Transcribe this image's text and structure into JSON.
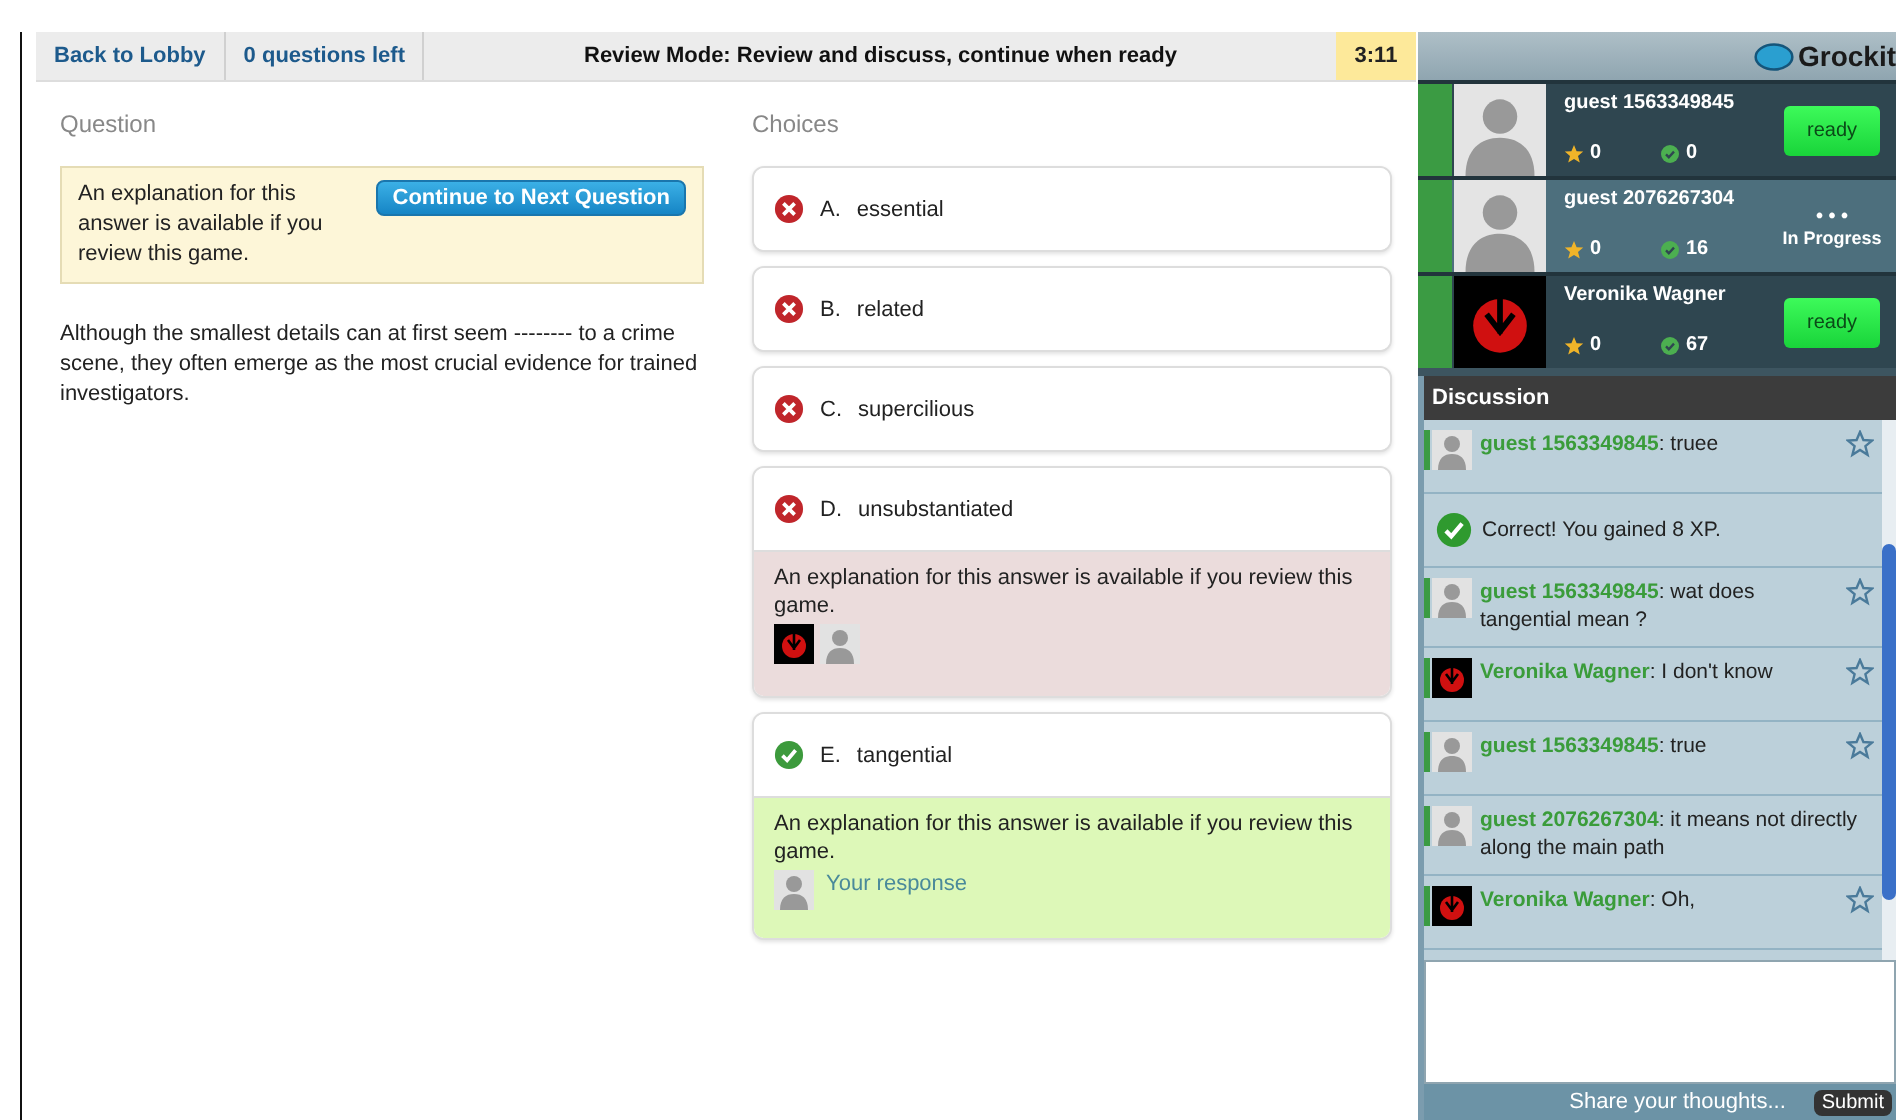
{
  "topbar": {
    "back": "Back to Lobby",
    "remaining": "0 questions left",
    "mode": "Review Mode: Review and discuss, continue when ready",
    "timer": "3:11"
  },
  "question": {
    "heading": "Question",
    "notice": "An explanation for this answer is available if you review this game.",
    "continue_button": "Continue to Next Question",
    "text": "Although the smallest details can at first seem -------- to a crime scene, they often emerge as the most crucial evidence for trained investigators."
  },
  "choices": {
    "heading": "Choices",
    "items": [
      {
        "letter": "A.",
        "text": "essential",
        "correct": false,
        "expanded": false
      },
      {
        "letter": "B.",
        "text": "related",
        "correct": false,
        "expanded": false
      },
      {
        "letter": "C.",
        "text": "supercilious",
        "correct": false,
        "expanded": false
      },
      {
        "letter": "D.",
        "text": "unsubstantiated",
        "correct": false,
        "expanded": true,
        "explanation": "An explanation for this answer is available if you review this game.",
        "responders": [
          {
            "kind": "emblem"
          },
          {
            "kind": "silhouette"
          }
        ]
      },
      {
        "letter": "E.",
        "text": "tangential",
        "correct": true,
        "expanded": true,
        "explanation": "An explanation for this answer is available if you review this game.",
        "responders": [
          {
            "kind": "silhouette",
            "label": "Your response"
          }
        ]
      }
    ]
  },
  "brand": {
    "name": "Grockit"
  },
  "players": [
    {
      "name": "guest 1563349845",
      "avatar": {
        "kind": "silhouette"
      },
      "points": "0",
      "correct_count": "0",
      "status": {
        "kind": "ready",
        "label": "ready"
      }
    },
    {
      "name": "guest 2076267304",
      "avatar": {
        "kind": "silhouette"
      },
      "points": "0",
      "correct_count": "16",
      "status": {
        "kind": "progress",
        "dots": "• • •",
        "label": "In Progress"
      }
    },
    {
      "name": "Veronika Wagner",
      "avatar": {
        "kind": "emblem"
      },
      "points": "0",
      "correct_count": "67",
      "status": {
        "kind": "ready",
        "label": "ready"
      }
    }
  ],
  "discussion": {
    "title": "Discussion",
    "messages": [
      {
        "kind": "chat",
        "avatar": {
          "kind": "silhouette"
        },
        "author": "guest 1563349845",
        "text": ": truee"
      },
      {
        "kind": "system",
        "text": "Correct! You gained 8 XP."
      },
      {
        "kind": "chat",
        "avatar": {
          "kind": "silhouette"
        },
        "author": "guest 1563349845",
        "text": ": wat does tangential mean ?"
      },
      {
        "kind": "chat",
        "avatar": {
          "kind": "emblem"
        },
        "author": "Veronika Wagner",
        "text": ": I don't know"
      },
      {
        "kind": "chat",
        "avatar": {
          "kind": "silhouette"
        },
        "author": "guest 1563349845",
        "text": ": true"
      },
      {
        "kind": "chat",
        "avatar": {
          "kind": "silhouette"
        },
        "author": "guest 2076267304",
        "text": ": it means not directly along the main path",
        "nostar": true
      },
      {
        "kind": "chat",
        "avatar": {
          "kind": "emblem"
        },
        "author": "Veronika Wagner",
        "text": ": Oh,"
      }
    ],
    "placeholder": "Share your thoughts...",
    "submit": "Submit"
  }
}
